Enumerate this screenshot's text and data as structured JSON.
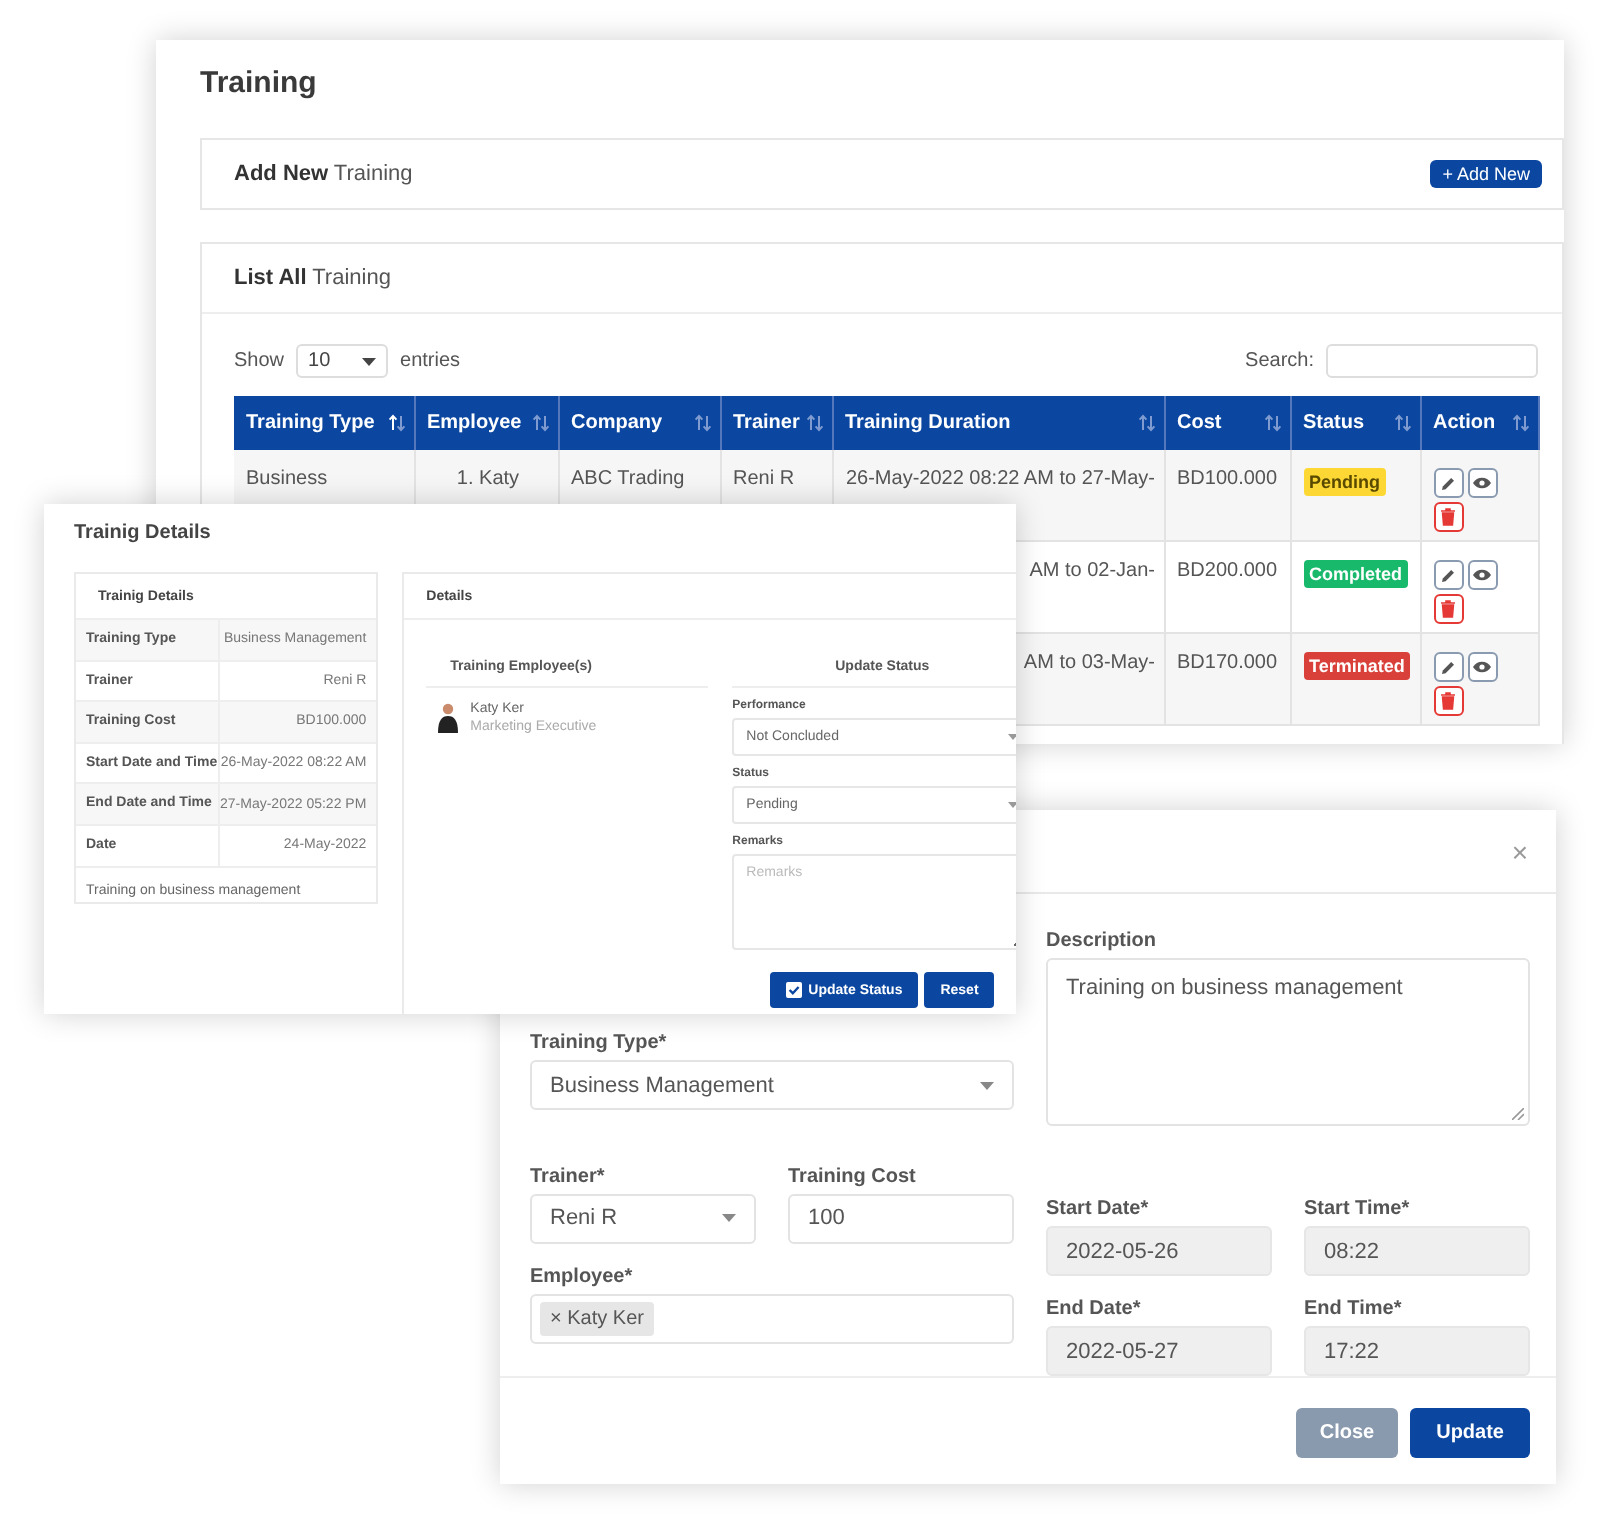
{
  "main_window": {
    "title": "Training",
    "add_card": {
      "title": "**Add New** Training",
      "button": "+ Add New"
    },
    "list_card": {
      "title": "**List All** Training",
      "show_label": "Show",
      "page_size": "10",
      "entries_label": "entries",
      "search_label": "Search:",
      "columns": [
        {
          "label": "Training Type",
          "sorted": true
        },
        {
          "label": "Employee",
          "sorted": false
        },
        {
          "label": "Company",
          "sorted": false
        },
        {
          "label": "Trainer",
          "sorted": false
        },
        {
          "label": "Training Duration",
          "sorted": false
        },
        {
          "label": "Cost",
          "sorted": false
        },
        {
          "label": "Status",
          "sorted": false
        },
        {
          "label": "Action",
          "sorted": false
        }
      ],
      "rows": [
        {
          "training_type": "Business",
          "employee": "1. Katy",
          "company": "ABC Trading",
          "trainer": "Reni R",
          "duration": "26-May-2022 08:22 AM to 27-May-",
          "cost": "BD100.000",
          "status": {
            "label": "Pending",
            "kind": "pending"
          }
        },
        {
          "duration": "AM to 02-Jan-",
          "cost": "BD200.000",
          "status": {
            "label": "Completed",
            "kind": "completed"
          }
        },
        {
          "duration": "AM to 03-May-",
          "cost": "BD170.000",
          "status": {
            "label": "Terminated",
            "kind": "terminated"
          }
        }
      ]
    }
  },
  "details_window": {
    "title": "Trainig Details",
    "summary": {
      "title": "Trainig Details",
      "rows": [
        {
          "label": "Training Type",
          "value": "Business Management"
        },
        {
          "label": "Trainer",
          "value": "Reni R"
        },
        {
          "label": "Training Cost",
          "value": "BD100.000"
        },
        {
          "label": "Start Date and Time",
          "value": "26-May-2022 08:22 AM"
        },
        {
          "label": "End Date and Time",
          "value": "27-May-2022 05:22 PM"
        },
        {
          "label": "Date",
          "value": "24-May-2022"
        }
      ],
      "note": "Training on business management"
    },
    "details": {
      "title": "Details",
      "employees_title": "Training Employee(s)",
      "employees": [
        {
          "name": "Katy Ker",
          "role": "Marketing Executive"
        }
      ],
      "update_title": "Update Status",
      "performance": {
        "label": "Performance",
        "value": "Not Concluded"
      },
      "status": {
        "label": "Status",
        "value": "Pending"
      },
      "remarks": {
        "label": "Remarks",
        "placeholder": "Remarks"
      },
      "buttons": [
        {
          "label": "Update Status",
          "kind": "check"
        },
        {
          "label": "Reset",
          "kind": "plain"
        }
      ]
    }
  },
  "edit_modal": {
    "close_symbol": "×",
    "training_type": {
      "label": "Training Type*",
      "value": "Business Management"
    },
    "trainer": {
      "label": "Trainer*",
      "value": "Reni R"
    },
    "training_cost": {
      "label": "Training Cost",
      "value": "100"
    },
    "employee": {
      "label": "Employee*",
      "remove_symbol": "×",
      "tags": [
        "Katy Ker"
      ]
    },
    "description": {
      "label": "Description",
      "value": "Training on business management"
    },
    "start_date": {
      "label": "Start Date*",
      "value": "2022-05-26"
    },
    "start_time": {
      "label": "Start Time*",
      "value": "08:22"
    },
    "end_date": {
      "label": "End Date*",
      "value": "2022-05-27"
    },
    "end_time": {
      "label": "End Time*",
      "value": "17:22"
    },
    "buttons": [
      {
        "label": "Close",
        "kind": "secondary"
      },
      {
        "label": "Update",
        "kind": "primary"
      }
    ]
  }
}
